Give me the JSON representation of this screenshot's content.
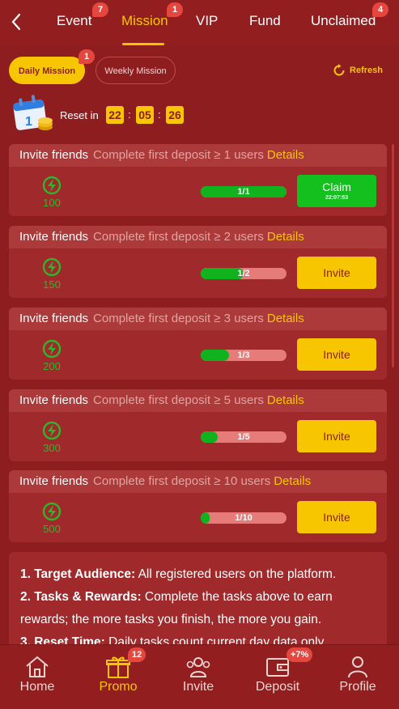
{
  "top_nav": {
    "tabs": [
      {
        "label": "Event",
        "badge": "7"
      },
      {
        "label": "Mission",
        "badge": "1"
      },
      {
        "label": "VIP"
      },
      {
        "label": "Fund"
      },
      {
        "label": "Unclaimed",
        "badge": "4"
      }
    ],
    "active_tab": "Mission"
  },
  "sub_tabs": {
    "daily": {
      "label": "Daily Mission",
      "badge": "1"
    },
    "weekly": {
      "label": "Weekly Mission"
    },
    "refresh": "Refresh"
  },
  "reset": {
    "label": "Reset in",
    "hours": "22",
    "minutes": "05",
    "seconds": "26"
  },
  "missions": [
    {
      "title": "Invite friends",
      "desc": "Complete first deposit ≥ 1 users",
      "details": "Details",
      "reward": "100",
      "progress": "1/1",
      "progress_fraction": 1.0,
      "button": "Claim",
      "button_time": "22:07:53"
    },
    {
      "title": "Invite friends",
      "desc": "Complete first deposit ≥ 2 users",
      "details": "Details",
      "reward": "150",
      "progress": "1/2",
      "progress_fraction": 0.5,
      "button": "Invite"
    },
    {
      "title": "Invite friends",
      "desc": "Complete first deposit ≥ 3 users",
      "details": "Details",
      "reward": "200",
      "progress": "1/3",
      "progress_fraction": 0.333,
      "button": "Invite"
    },
    {
      "title": "Invite friends",
      "desc": "Complete first deposit ≥ 5 users",
      "details": "Details",
      "reward": "300",
      "progress": "1/5",
      "progress_fraction": 0.2,
      "button": "Invite"
    },
    {
      "title": "Invite friends",
      "desc": "Complete first deposit ≥ 10 users",
      "details": "Details",
      "reward": "500",
      "progress": "1/10",
      "progress_fraction": 0.1,
      "button": "Invite"
    }
  ],
  "rules": [
    {
      "head": "1. Target Audience:",
      "text": " All registered users on the platform."
    },
    {
      "head": "2. Tasks & Rewards:",
      "text": " Complete the tasks above to earn rewards; the more tasks you finish, the more you gain."
    },
    {
      "head": "3. Reset Time:",
      "text": " Daily tasks count current day data only."
    }
  ],
  "bottom_nav": {
    "items": [
      {
        "label": "Home",
        "icon": "home-icon"
      },
      {
        "label": "Promo",
        "icon": "gift-icon",
        "badge": "12"
      },
      {
        "label": "Invite",
        "icon": "users-icon"
      },
      {
        "label": "Deposit",
        "icon": "wallet-icon",
        "badge": "+7%"
      },
      {
        "label": "Profile",
        "icon": "user-icon"
      }
    ],
    "active": "Promo"
  },
  "colors": {
    "background": "#8e1d1f",
    "accent": "#f7c600",
    "success": "#14c01e",
    "badge": "#e5473e"
  }
}
